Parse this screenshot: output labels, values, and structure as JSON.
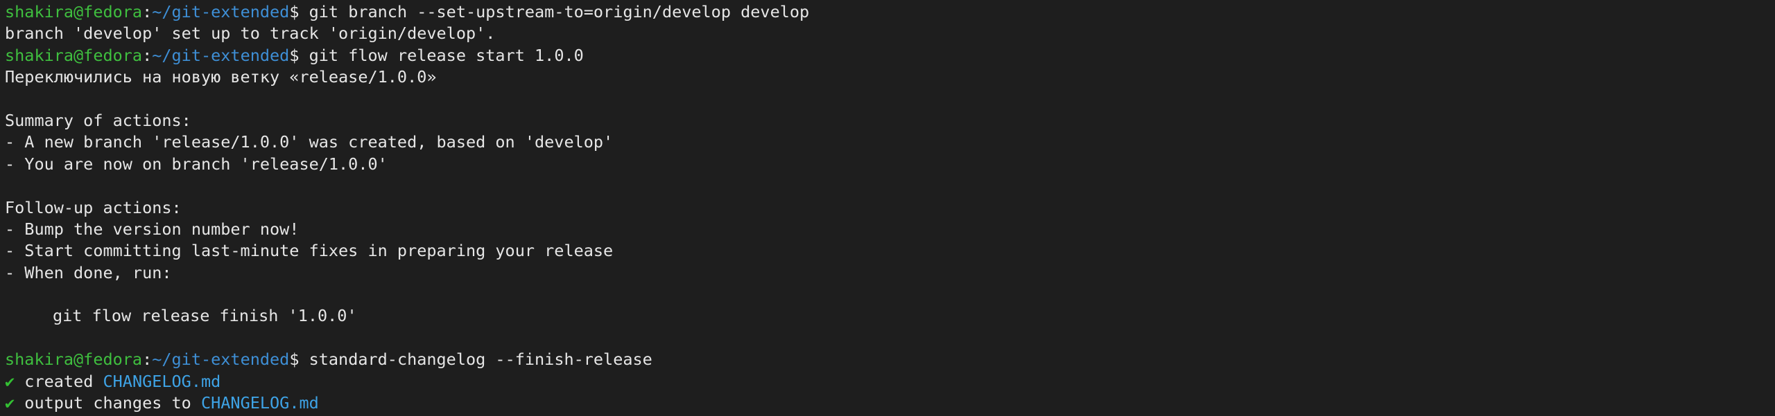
{
  "prompt": {
    "user_host": "shakira@fedora",
    "separator": ":",
    "path": "~/git-extended",
    "sign": "$ "
  },
  "commands": {
    "c1": "git branch --set-upstream-to=origin/develop develop",
    "c2": "git flow release start 1.0.0",
    "c3": "standard-changelog --finish-release"
  },
  "output": {
    "upstream_msg": "branch 'develop' set up to track 'origin/develop'.",
    "switched_msg": "Переключились на новую ветку «release/1.0.0»",
    "summary_header": "Summary of actions:",
    "summary_1": "- A new branch 'release/1.0.0' was created, based on 'develop'",
    "summary_2": "- You are now on branch 'release/1.0.0'",
    "followup_header": "Follow-up actions:",
    "followup_1": "- Bump the version number now!",
    "followup_2": "- Start committing last-minute fixes in preparing your release",
    "followup_3": "- When done, run:",
    "finish_cmd": "git flow release finish '1.0.0'",
    "check_symbol": "✔",
    "created_label": " created ",
    "created_file": "CHANGELOG.md",
    "output_label": " output changes to ",
    "output_file": "CHANGELOG.md"
  }
}
